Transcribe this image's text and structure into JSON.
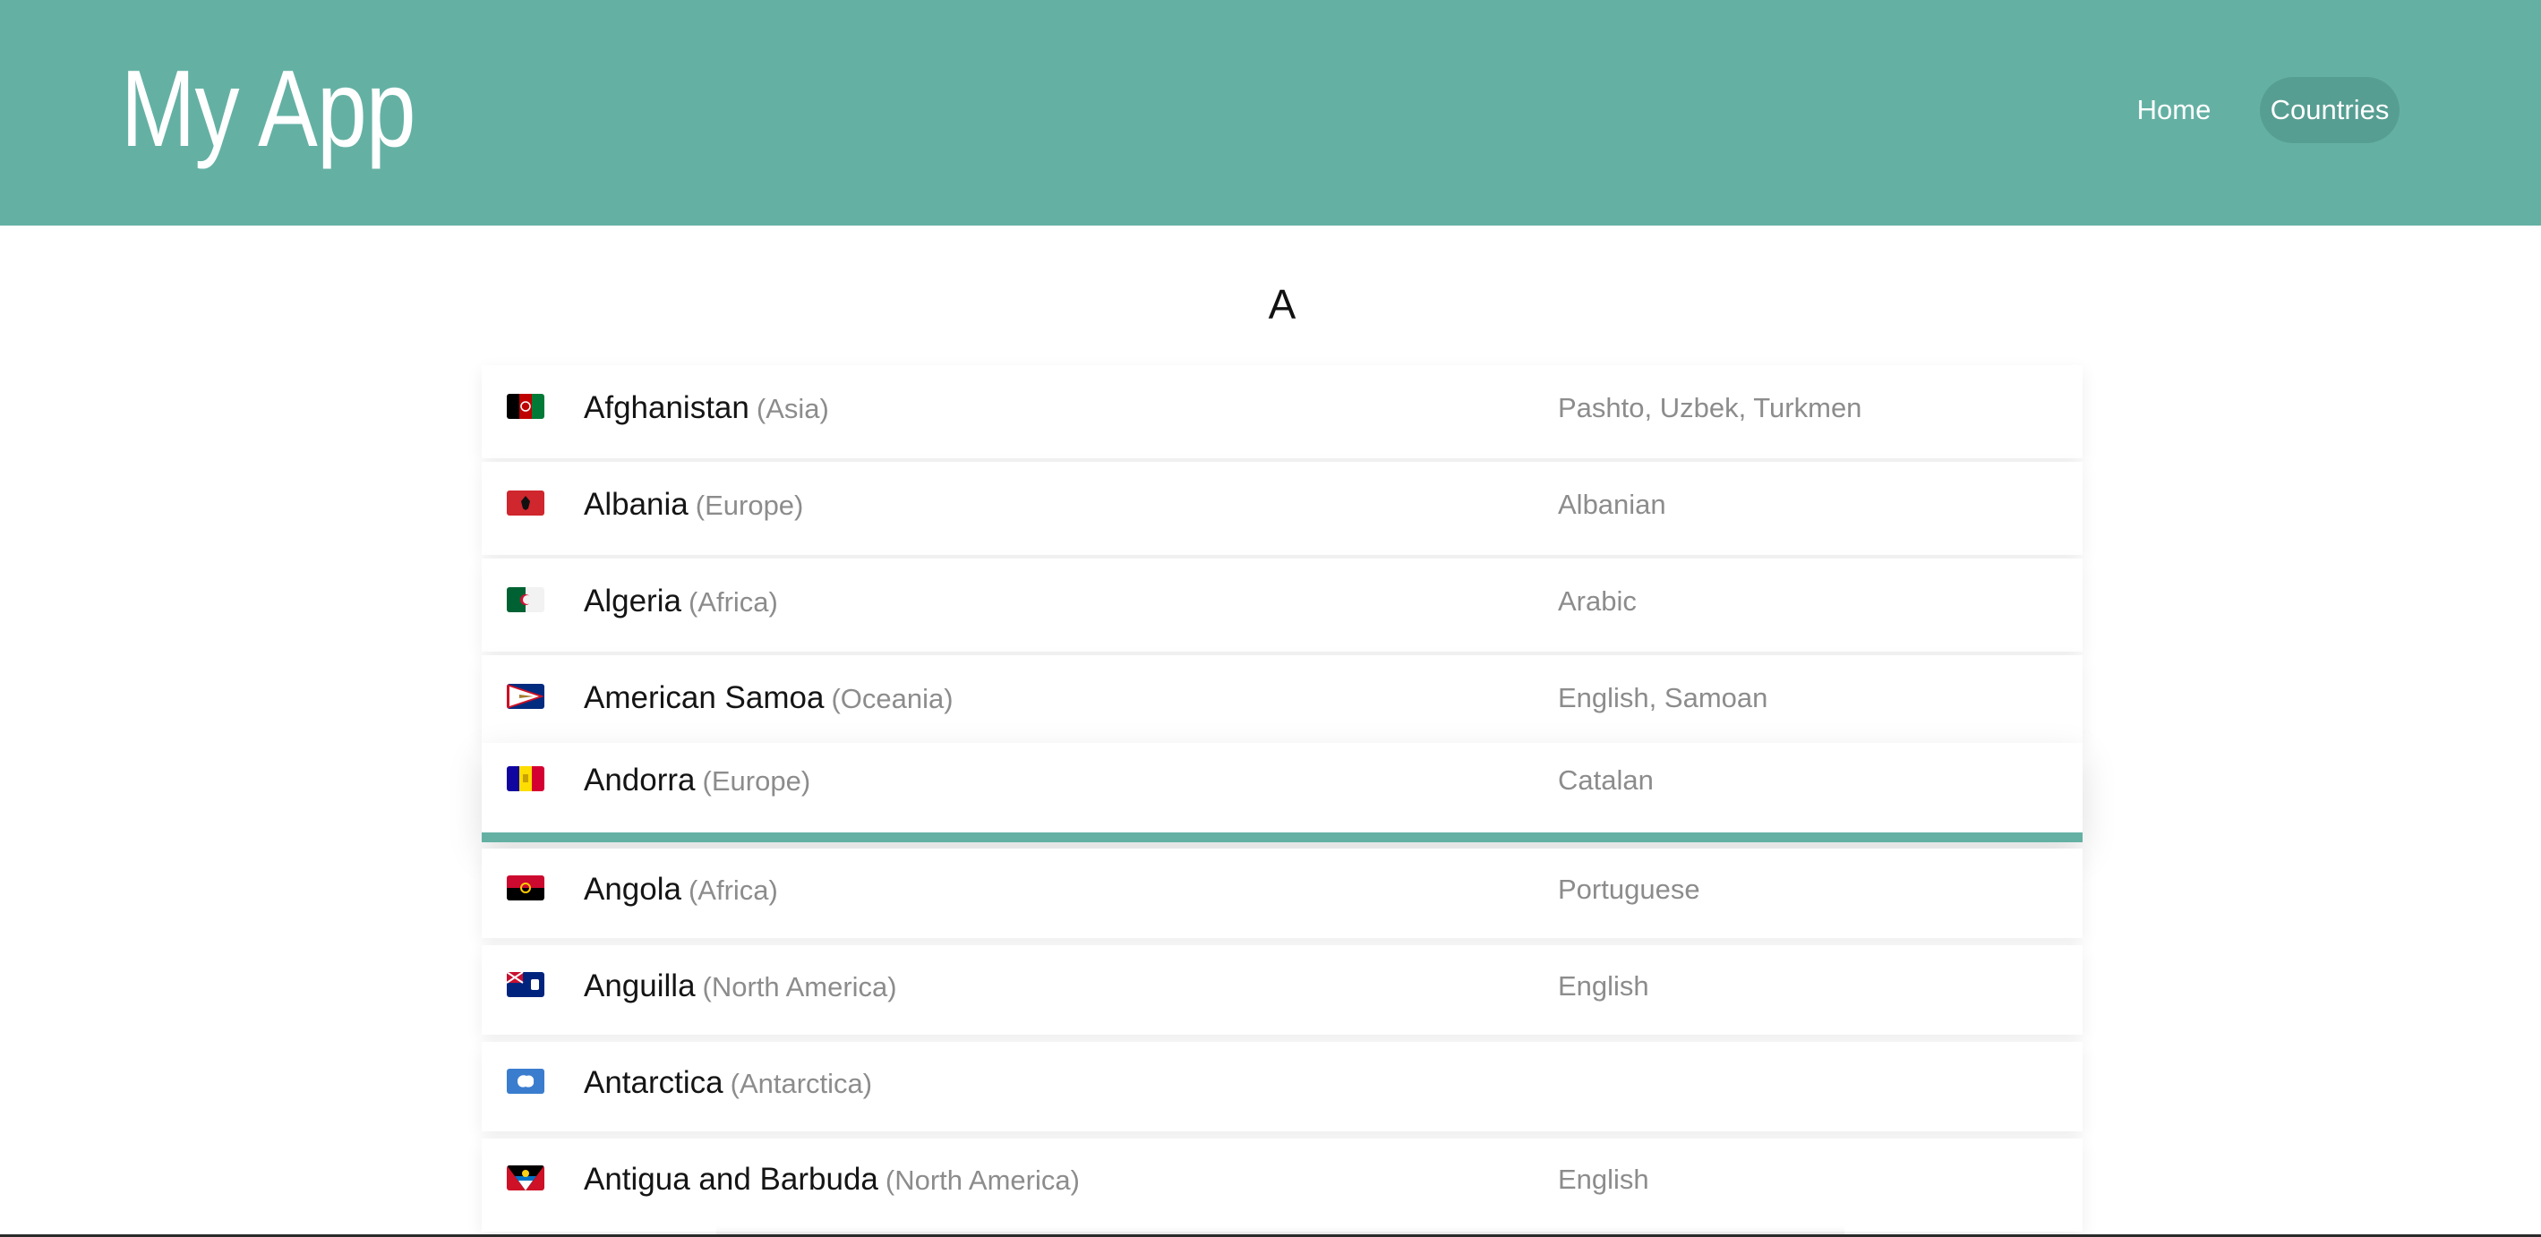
{
  "header": {
    "app_title": "My App",
    "nav": {
      "home": "Home",
      "countries": "Countries"
    },
    "background_color": "#64b1a4",
    "active_nav_color": "#579e92"
  },
  "section": {
    "letter": "A"
  },
  "countries": [
    {
      "name": "Afghanistan",
      "region": "(Asia)",
      "languages": "Pashto, Uzbek, Turkmen",
      "flag_icon": "flag-afghanistan-icon"
    },
    {
      "name": "Albania",
      "region": "(Europe)",
      "languages": "Albanian",
      "flag_icon": "flag-albania-icon"
    },
    {
      "name": "Algeria",
      "region": "(Africa)",
      "languages": "Arabic",
      "flag_icon": "flag-algeria-icon"
    },
    {
      "name": "American Samoa",
      "region": "(Oceania)",
      "languages": "English, Samoan",
      "flag_icon": "flag-american-samoa-icon"
    },
    {
      "name": "Andorra",
      "region": "(Europe)",
      "languages": "Catalan",
      "flag_icon": "flag-andorra-icon",
      "selected": true
    },
    {
      "name": "Angola",
      "region": "(Africa)",
      "languages": "Portuguese",
      "flag_icon": "flag-angola-icon"
    },
    {
      "name": "Anguilla",
      "region": "(North America)",
      "languages": "English",
      "flag_icon": "flag-anguilla-icon"
    },
    {
      "name": "Antarctica",
      "region": "(Antarctica)",
      "languages": "",
      "flag_icon": "flag-antarctica-icon"
    },
    {
      "name": "Antigua and Barbuda",
      "region": "(North America)",
      "languages": "English",
      "flag_icon": "flag-antigua-and-barbuda-icon"
    }
  ]
}
